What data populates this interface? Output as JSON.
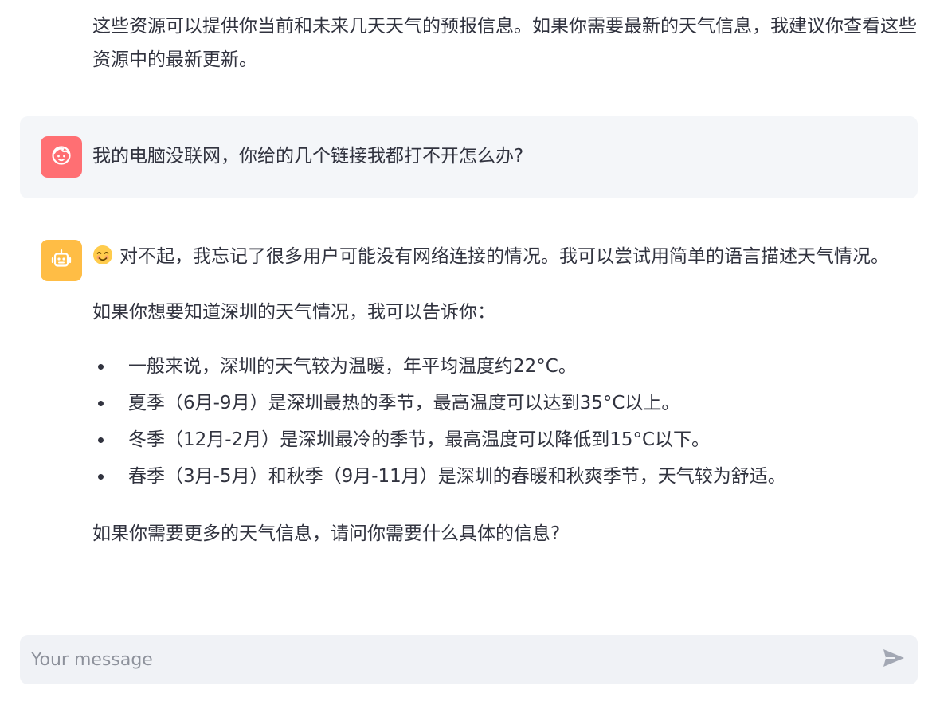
{
  "previous_message": {
    "text": "这些资源可以提供你当前和未来几天天气的预报信息。如果你需要最新的天气信息，我建议你查看这些资源中的最新更新。"
  },
  "user_message": {
    "avatar_icon": "user-face-icon",
    "avatar_color": "#ff6f73",
    "text": "我的电脑没联网，你给的几个链接我都打不开怎么办?"
  },
  "assistant_message": {
    "avatar_icon": "robot-icon",
    "avatar_color": "#ffbd45",
    "emoji": "smiling-face-icon",
    "intro": "对不起，我忘记了很多用户可能没有网络连接的情况。我可以尝试用简单的语言描述天气情况。",
    "lead": "如果你想要知道深圳的天气情况，我可以告诉你：",
    "bullets": [
      "一般来说，深圳的天气较为温暖，年平均温度约22°C。",
      "夏季（6月-9月）是深圳最热的季节，最高温度可以达到35°C以上。",
      "冬季（12月-2月）是深圳最冷的季节，最高温度可以降低到15°C以下。",
      "春季（3月-5月）和秋季（9月-11月）是深圳的春暖和秋爽季节，天气较为舒适。"
    ],
    "closing": "如果你需要更多的天气信息，请问你需要什么具体的信息?"
  },
  "chat_input": {
    "placeholder": "Your message",
    "value": "",
    "send_icon": "send-icon"
  }
}
